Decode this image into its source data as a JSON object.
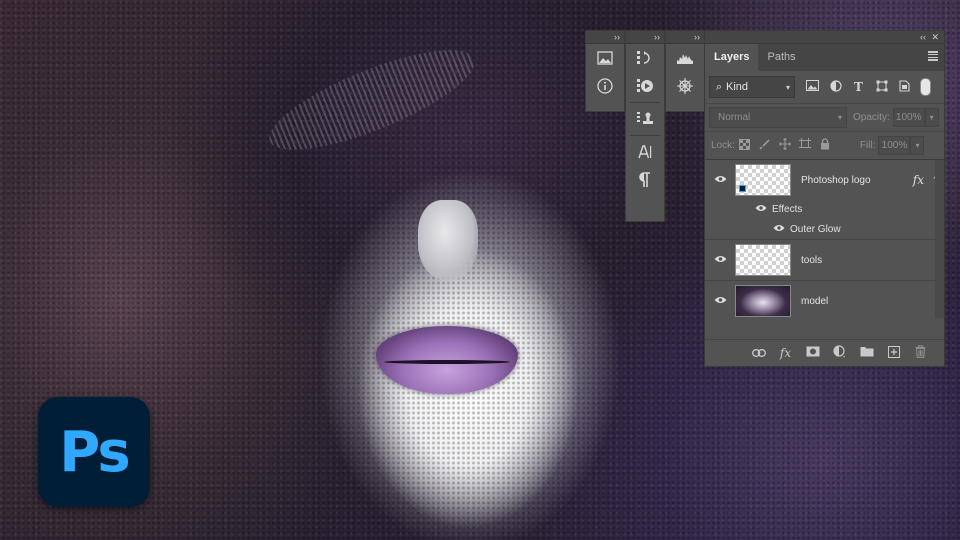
{
  "logo": {
    "text": "Ps"
  },
  "dock_columns": [
    {
      "header": "››",
      "buttons": [
        "image-icon",
        "info-icon"
      ]
    },
    {
      "header": "››",
      "buttons": [
        "history-icon",
        "actions-icon",
        "clone-source-icon",
        "character-icon",
        "paragraph-icon"
      ]
    },
    {
      "header": "››",
      "buttons": [
        "histogram-icon",
        "navigator-icon"
      ]
    }
  ],
  "layers_panel": {
    "collapse_label": "‹‹",
    "close_label": "✕",
    "tabs": [
      {
        "label": "Layers",
        "active": true
      },
      {
        "label": "Paths",
        "active": false
      }
    ],
    "filter": {
      "kind_label": "Kind"
    },
    "blend_mode": "Normal",
    "opacity_label": "Opacity:",
    "opacity_value": "100%",
    "lock_label": "Lock:",
    "fill_label": "Fill:",
    "fill_value": "100%",
    "layers": [
      {
        "name": "Photoshop logo",
        "visible": true,
        "has_fx": true,
        "fx_label": "fx",
        "effects_label": "Effects",
        "effect_items": [
          "Outer Glow"
        ]
      },
      {
        "name": "tools",
        "visible": true
      },
      {
        "name": "model",
        "visible": true
      }
    ],
    "bottom_icons": [
      "link-layers-icon",
      "add-style-icon",
      "add-mask-icon",
      "adjustment-layer-icon",
      "new-group-icon",
      "new-layer-icon",
      "delete-layer-icon"
    ],
    "bottom_fx_label": "fx"
  },
  "colors": {
    "panel_bg": "#535353",
    "panel_header": "#454545",
    "ps_logo_bg": "#001e36",
    "ps_logo_text": "#31a8ff",
    "lip_color": "#9a71b7"
  }
}
